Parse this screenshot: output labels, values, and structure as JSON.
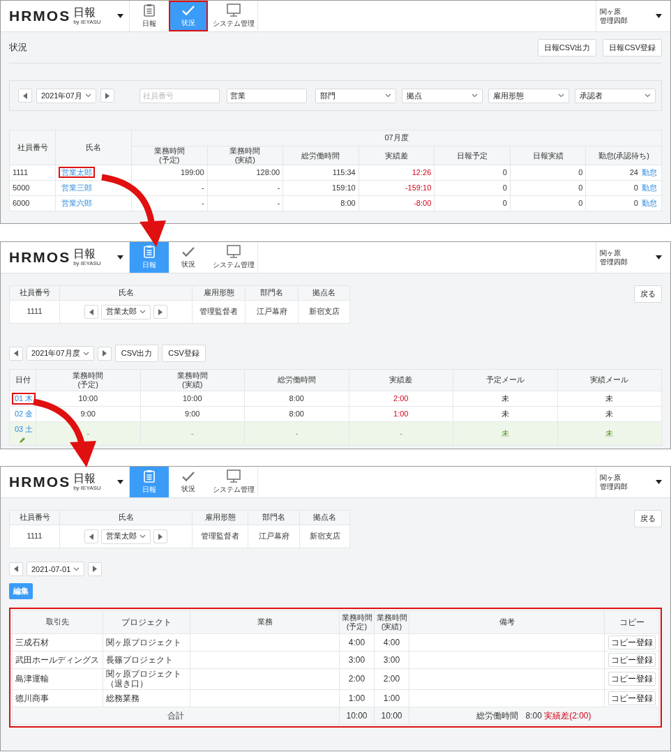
{
  "status_screen": {
    "header": {
      "logo": "HRMOS",
      "product": "日報",
      "byline": "by IEYASU",
      "nav": [
        {
          "kind": "clipboard",
          "label": "日報",
          "selected": false,
          "highlighted": false
        },
        {
          "kind": "check",
          "label": "状況",
          "selected": true,
          "highlighted": true
        },
        {
          "kind": "monitor",
          "label": "システム管理",
          "selected": false,
          "highlighted": false
        }
      ],
      "user": [
        "関ヶ原",
        "管理四郎"
      ]
    },
    "page_title": "状況",
    "buttons": [
      "日報CSV出力",
      "日報CSV登録"
    ],
    "filters": {
      "month": "2021年07月",
      "employee_number_placeholder": "社員番号",
      "keyword": "営業",
      "dropdowns": [
        "部門",
        "拠点",
        "雇用形態",
        "承認者"
      ]
    },
    "table": {
      "period": "07月度",
      "columns": [
        "社員番号",
        "氏名",
        "業務時間\n(予定)",
        "業務時間\n(実績)",
        "総労働時間",
        "実績差",
        "日報予定",
        "日報実績",
        "勤怠(承認待ち)"
      ],
      "rows": [
        {
          "employee_number": "1111",
          "name": "営業太郎",
          "highlighted": true,
          "planned": "199:00",
          "actual": "128:00",
          "total": "115:34",
          "difference": "12:26",
          "report_planned": "0",
          "report_actual": "0",
          "pending": "24",
          "attendance_link": "勤怠"
        },
        {
          "employee_number": "5000",
          "name": "営業三郎",
          "highlighted": false,
          "planned": "-",
          "actual": "-",
          "total": "159:10",
          "difference": "-159:10",
          "report_planned": "0",
          "report_actual": "0",
          "pending": "0",
          "attendance_link": "勤怠"
        },
        {
          "employee_number": "6000",
          "name": "営業六郎",
          "highlighted": false,
          "planned": "-",
          "actual": "-",
          "total": "8:00",
          "difference": "-8:00",
          "report_planned": "0",
          "report_actual": "0",
          "pending": "0",
          "attendance_link": "勤怠"
        }
      ]
    }
  },
  "monthly_screen": {
    "header": {
      "logo": "HRMOS",
      "product": "日報",
      "byline": "by IEYASU",
      "nav": [
        {
          "kind": "clipboard",
          "label": "日報",
          "selected": true,
          "highlighted": false
        },
        {
          "kind": "check",
          "label": "状況",
          "selected": false,
          "highlighted": false
        },
        {
          "kind": "monitor",
          "label": "システム管理",
          "selected": false,
          "highlighted": false
        }
      ],
      "user": [
        "関ヶ原",
        "管理四郎"
      ]
    },
    "employee": {
      "columns": [
        "社員番号",
        "氏名",
        "雇用形態",
        "部門名",
        "拠点名"
      ],
      "employee_number": "1111",
      "name": "営業太郎",
      "employment_type": "管理監督者",
      "department": "江戸幕府",
      "branch": "新宿支店"
    },
    "back_button": "戻る",
    "period": "2021年07月度",
    "buttons": [
      "CSV出力",
      "CSV登録"
    ],
    "table": {
      "columns": [
        "日付",
        "業務時間\n(予定)",
        "業務時間\n(実績)",
        "総労働時間",
        "実績差",
        "予定メール",
        "実績メール"
      ],
      "rows": [
        {
          "date": "01 木",
          "highlighted": true,
          "holiday": false,
          "editable": false,
          "planned": "10:00",
          "actual": "10:00",
          "total": "8:00",
          "difference": "2:00",
          "plan_mail": "未",
          "result_mail": "未"
        },
        {
          "date": "02 金",
          "highlighted": false,
          "holiday": false,
          "editable": false,
          "planned": "9:00",
          "actual": "9:00",
          "total": "8:00",
          "difference": "1:00",
          "plan_mail": "未",
          "result_mail": "未"
        },
        {
          "date": "03 土",
          "highlighted": false,
          "holiday": true,
          "editable": true,
          "planned": "-",
          "actual": "-",
          "total": "-",
          "difference": "-",
          "plan_mail": "未",
          "result_mail": "未"
        }
      ]
    }
  },
  "daily_screen": {
    "header": {
      "logo": "HRMOS",
      "product": "日報",
      "byline": "by IEYASU",
      "nav": [
        {
          "kind": "clipboard",
          "label": "日報",
          "selected": true,
          "highlighted": false
        },
        {
          "kind": "check",
          "label": "状況",
          "selected": false,
          "highlighted": false
        },
        {
          "kind": "monitor",
          "label": "システム管理",
          "selected": false,
          "highlighted": false
        }
      ],
      "user": [
        "関ヶ原",
        "管理四郎"
      ]
    },
    "employee": {
      "columns": [
        "社員番号",
        "氏名",
        "雇用形態",
        "部門名",
        "拠点名"
      ],
      "employee_number": "1111",
      "name": "営業太郎",
      "employment_type": "管理監督者",
      "department": "江戸幕府",
      "branch": "新宿支店"
    },
    "back_button": "戻る",
    "date": "2021-07-01",
    "edit_button": "編集",
    "table": {
      "highlighted": true,
      "columns": [
        "取引先",
        "プロジェクト",
        "業務",
        "業務時間\n(予定)",
        "業務時間\n(実績)",
        "備考",
        "コピー"
      ],
      "rows": [
        {
          "client": "三成石材",
          "project": "関ヶ原プロジェクト",
          "planned": "4:00",
          "actual": "4:00",
          "copy_button": "コピー登録"
        },
        {
          "client": "武田ホールディングス",
          "project": "長篠プロジェクト",
          "planned": "3:00",
          "actual": "3:00",
          "copy_button": "コピー登録"
        },
        {
          "client": "島津運輸",
          "project": "関ヶ原プロジェクト（退き口）",
          "planned": "2:00",
          "actual": "2:00",
          "copy_button": "コピー登録"
        },
        {
          "client": "徳川商事",
          "project": "総務業務",
          "planned": "1:00",
          "actual": "1:00",
          "copy_button": "コピー登録"
        }
      ],
      "total": {
        "label": "合計",
        "planned": "10:00",
        "actual": "10:00",
        "total_label": "総労働時間",
        "total": "8:00",
        "difference": "実績差(2:00)"
      }
    }
  }
}
